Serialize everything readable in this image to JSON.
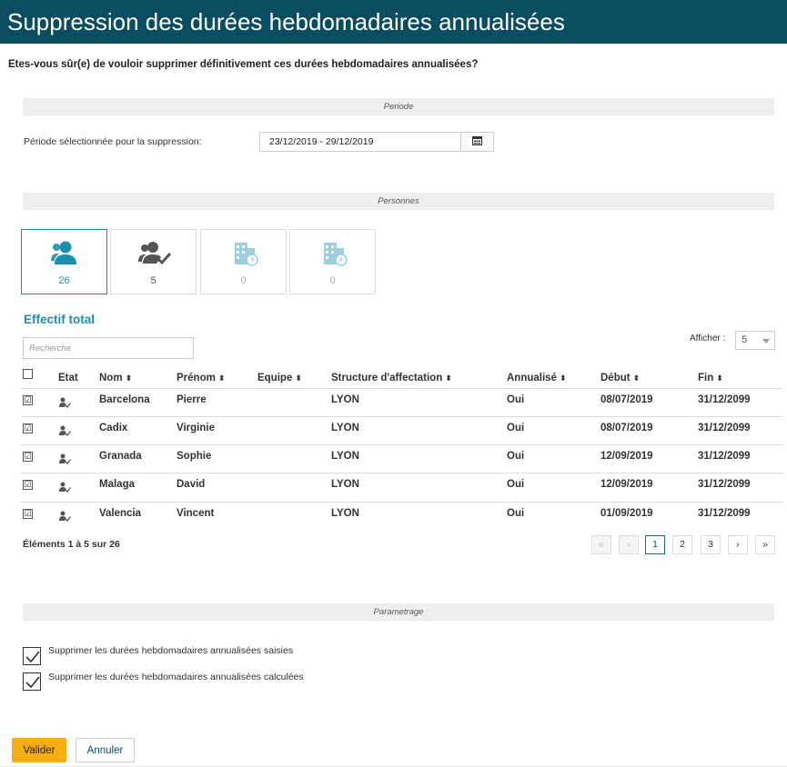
{
  "title": "Suppression des durées hebdomadaires annualisées",
  "question": "Etes-vous sûr(e) de vouloir supprimer définitivement ces durées hebdomadaires annualisées?",
  "sections": {
    "periode": "Periode",
    "personnes": "Personnes",
    "parametrage": "Parametrage"
  },
  "periode": {
    "label": "Période sélectionnée pour la suppression:",
    "value": "23/12/2019 - 29/12/2019",
    "button_icon": "calendar-icon"
  },
  "tiles": [
    {
      "icon": "person-icon",
      "count": "26"
    },
    {
      "icon": "person-check-icon",
      "count": "5"
    },
    {
      "icon": "building-clock-icon",
      "count": "0"
    },
    {
      "icon": "building-history-icon",
      "count": "0"
    }
  ],
  "effectif_title": "Effectif total",
  "search": {
    "placeholder": "Recherche"
  },
  "afficher": {
    "label": "Afficher :",
    "value": "5"
  },
  "columns": [
    "Etat",
    "Nom",
    "Prénom",
    "Equipe",
    "Structure d'affectation",
    "Annualisé",
    "Début",
    "Fin"
  ],
  "rows": [
    {
      "checked": "☑",
      "nom": "Barcelona",
      "prenom": "Pierre",
      "equipe": "",
      "structure": "LYON",
      "annualise": "Oui",
      "debut": "08/07/2019",
      "fin": "31/12/2099"
    },
    {
      "checked": "☑",
      "nom": "Cadix",
      "prenom": "Virginie",
      "equipe": "",
      "structure": "LYON",
      "annualise": "Oui",
      "debut": "08/07/2019",
      "fin": "31/12/2099"
    },
    {
      "checked": "☑",
      "nom": "Granada",
      "prenom": "Sophie",
      "equipe": "",
      "structure": "LYON",
      "annualise": "Oui",
      "debut": "12/09/2019",
      "fin": "31/12/2099"
    },
    {
      "checked": "☑",
      "nom": "Malaga",
      "prenom": "David",
      "equipe": "",
      "structure": "LYON",
      "annualise": "Oui",
      "debut": "12/09/2019",
      "fin": "31/12/2099"
    },
    {
      "checked": "☑",
      "nom": "Valencia",
      "prenom": "Vincent",
      "equipe": "",
      "structure": "LYON",
      "annualise": "Oui",
      "debut": "01/09/2019",
      "fin": "31/12/2099"
    }
  ],
  "pagination": {
    "summary": "Éléments 1 à 5 sur 26",
    "first": "«",
    "prev": "‹",
    "pages": [
      "1",
      "2",
      "3"
    ],
    "next": "›",
    "last": "»",
    "current_page": 1
  },
  "parametrage": {
    "option1": "Supprimer les durées hebdomadaires annualisées saisies",
    "option2": "Supprimer les durées hebdomadaires annualisées calculées"
  },
  "buttons": {
    "valider": "Valider",
    "annuler": "Annuler"
  },
  "colors": {
    "header_bg": "#0a4d60",
    "accent": "#1a8fb0",
    "primary_button": "#f6ae14"
  }
}
